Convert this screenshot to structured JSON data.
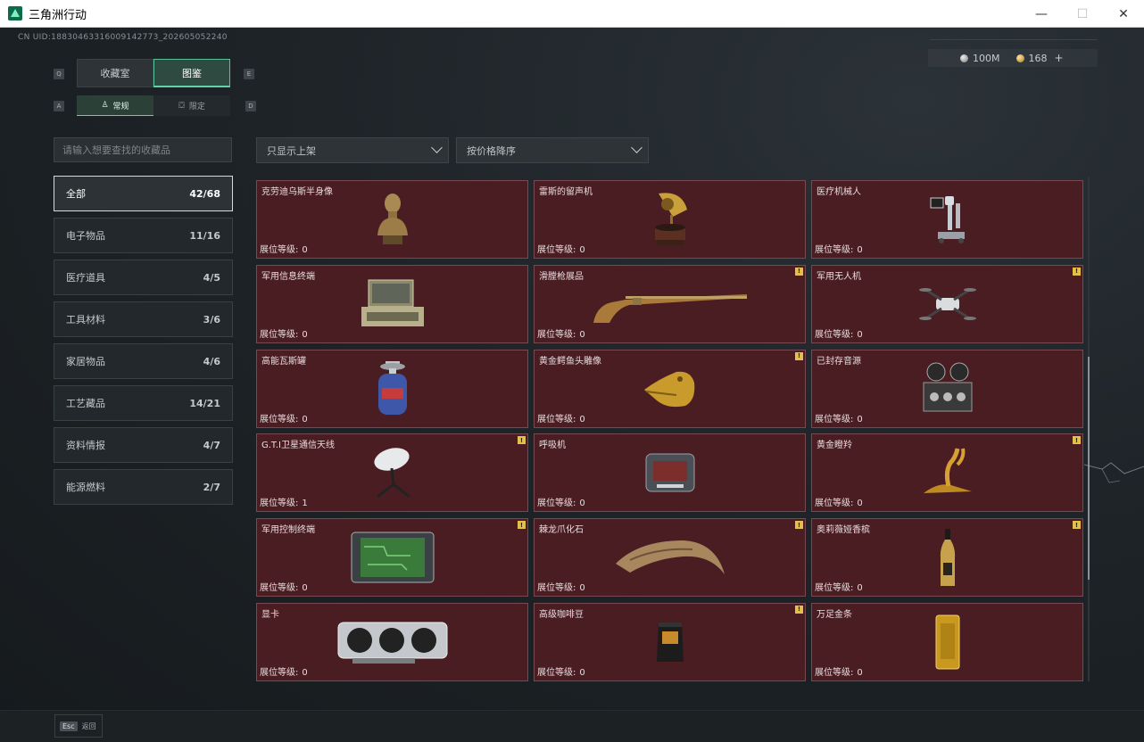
{
  "window": {
    "title": "三角洲行动",
    "controls": {
      "minimize": "—",
      "maximize": "☐",
      "close": "✕"
    }
  },
  "header": {
    "uid": "CN UID:18830463316009142773_202605052240",
    "currency": {
      "silver": "100M",
      "gold": "168",
      "add": "+"
    }
  },
  "key_hints": {
    "prev_tab": "Q",
    "next_tab": "E",
    "prev_sub": "A",
    "next_sub": "D"
  },
  "tabs": [
    {
      "label": "收藏室",
      "active": false
    },
    {
      "label": "图鉴",
      "active": true
    }
  ],
  "subtabs": [
    {
      "label": "常规",
      "icon": "♙",
      "active": true
    },
    {
      "label": "限定",
      "icon": "⛋",
      "active": false
    }
  ],
  "search": {
    "placeholder": "请输入想要查找的收藏品",
    "value": ""
  },
  "filters": {
    "listing": "只显示上架",
    "sort": "按价格降序"
  },
  "categories": [
    {
      "label": "全部",
      "count": "42/68",
      "active": true
    },
    {
      "label": "电子物品",
      "count": "11/16"
    },
    {
      "label": "医疗道具",
      "count": "4/5"
    },
    {
      "label": "工具材料",
      "count": "3/6"
    },
    {
      "label": "家居物品",
      "count": "4/6"
    },
    {
      "label": "工艺藏品",
      "count": "14/21"
    },
    {
      "label": "资料情报",
      "count": "4/7"
    },
    {
      "label": "能源燃料",
      "count": "2/7"
    }
  ],
  "level_label": "展位等级:",
  "items": [
    {
      "name": "克劳迪乌斯半身像",
      "level": "0",
      "badge": false,
      "icon": "bust-icon"
    },
    {
      "name": "雷斯的留声机",
      "level": "0",
      "badge": false,
      "icon": "gramophone-icon"
    },
    {
      "name": "医疗机械人",
      "level": "0",
      "badge": false,
      "icon": "medical-robot-icon"
    },
    {
      "name": "军用信息终端",
      "level": "0",
      "badge": false,
      "icon": "terminal-icon"
    },
    {
      "name": "滑膛枪展品",
      "level": "0",
      "badge": true,
      "icon": "musket-icon"
    },
    {
      "name": "军用无人机",
      "level": "0",
      "badge": true,
      "icon": "drone-icon"
    },
    {
      "name": "高能瓦斯罐",
      "level": "0",
      "badge": false,
      "icon": "gas-tank-icon"
    },
    {
      "name": "黄金鳄鱼头雕像",
      "level": "0",
      "badge": true,
      "icon": "croc-head-icon"
    },
    {
      "name": "已封存音源",
      "level": "0",
      "badge": false,
      "icon": "reel-recorder-icon"
    },
    {
      "name": "G.T.I卫星通信天线",
      "level": "1",
      "badge": true,
      "icon": "satellite-dish-icon"
    },
    {
      "name": "呼吸机",
      "level": "0",
      "badge": false,
      "icon": "ventilator-icon"
    },
    {
      "name": "黄金瞪羚",
      "level": "0",
      "badge": true,
      "icon": "gold-gazelle-icon"
    },
    {
      "name": "军用控制终端",
      "level": "0",
      "badge": true,
      "icon": "control-terminal-icon"
    },
    {
      "name": "棘龙爪化石",
      "level": "0",
      "badge": true,
      "icon": "claw-fossil-icon"
    },
    {
      "name": "奥莉薇娅香槟",
      "level": "0",
      "badge": true,
      "icon": "champagne-icon"
    },
    {
      "name": "显卡",
      "level": "0",
      "badge": false,
      "icon": "gpu-icon"
    },
    {
      "name": "高级咖啡豆",
      "level": "0",
      "badge": true,
      "icon": "coffee-bag-icon"
    },
    {
      "name": "万足金条",
      "level": "0",
      "badge": false,
      "icon": "gold-bar-icon"
    }
  ],
  "badge_glyph": "!",
  "footer": {
    "esc_key": "Esc",
    "esc_label": "返回"
  },
  "colors": {
    "accent": "#5fd4a6",
    "card_bg": "#4a1d23",
    "badge": "#e4c04a"
  }
}
